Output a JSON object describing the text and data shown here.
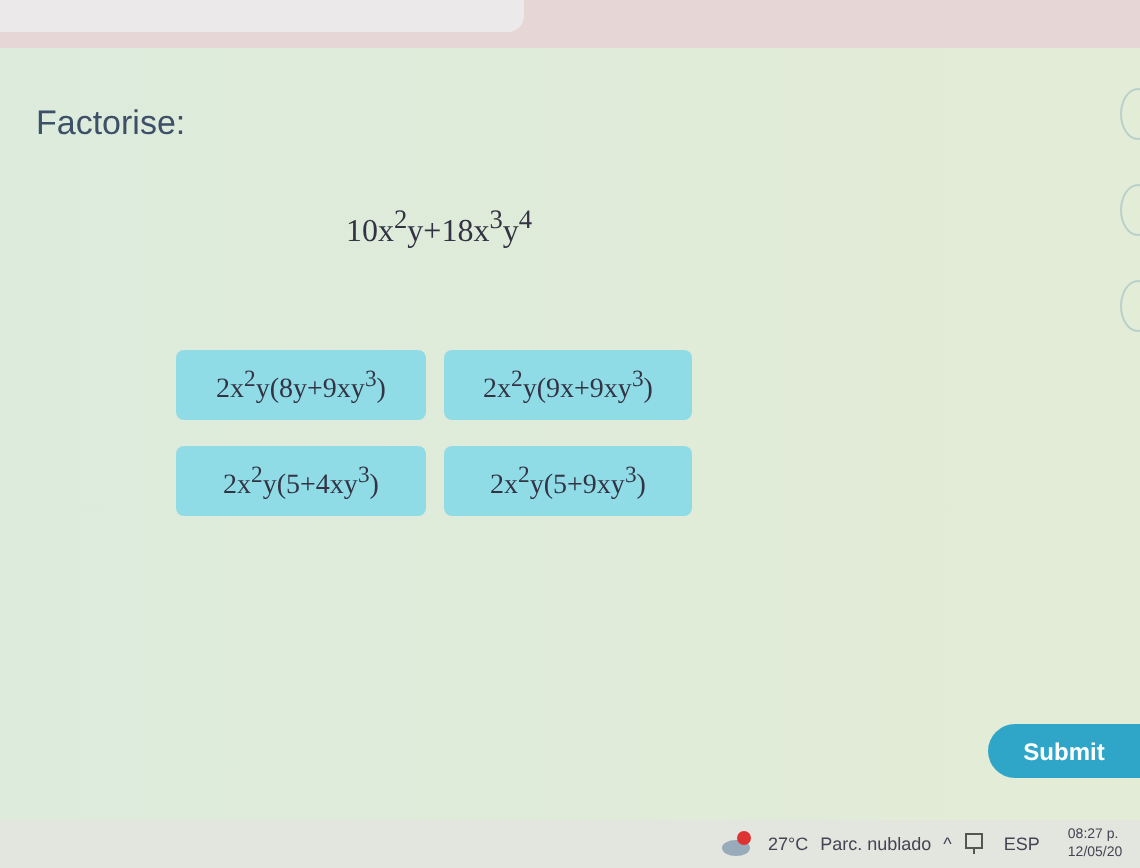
{
  "prompt": "Factorise:",
  "expression": "10x$^{2}$y+18x$^{3}$y$^{4}$",
  "options": [
    {
      "label": "2x$^{2}$y(8y+9xy$^{3}$)"
    },
    {
      "label": "2x$^{2}$y(9x+9xy$^{3}$)"
    },
    {
      "label": "2x$^{2}$y(5+4xy$^{3}$)"
    },
    {
      "label": "2x$^{2}$y(5+9xy$^{3}$)"
    }
  ],
  "submit": "Submit",
  "taskbar": {
    "temperature": "27°C",
    "weather": "Parc. nublado",
    "chevron": "^",
    "language": "ESP",
    "time": "08:27 p.",
    "date": "12/05/20"
  }
}
